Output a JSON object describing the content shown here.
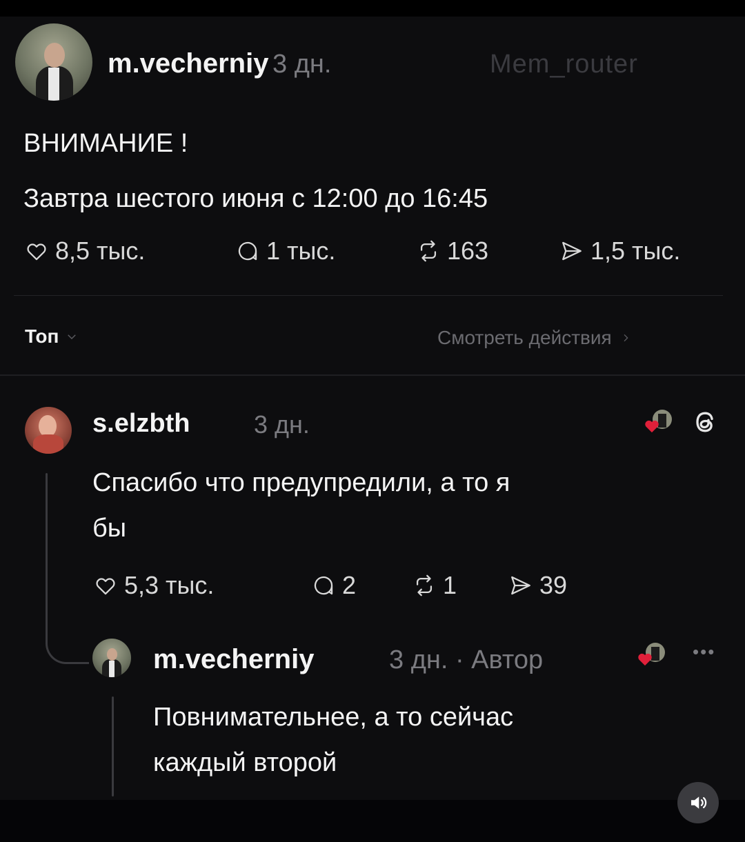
{
  "post": {
    "username": "m.vecherniy",
    "time": "3 дн.",
    "watermark": "Mem_router",
    "title": "ВНИМАНИЕ !",
    "body": "Завтра шестого июня с 12:00 до 16:45",
    "stats": {
      "likes": "8,5 тыс.",
      "comments": "1 тыс.",
      "reposts": "163",
      "shares": "1,5 тыс."
    }
  },
  "sort": {
    "label": "Топ",
    "actions_link": "Смотреть действия"
  },
  "reply1": {
    "username": "s.elzbth",
    "time": "3 дн.",
    "text_line1": "Спасибо что предупредили, а то я",
    "text_line2": "бы",
    "stats": {
      "likes": "5,3 тыс.",
      "comments": "2",
      "reposts": "1",
      "shares": "39"
    }
  },
  "reply2": {
    "username": "m.vecherniy",
    "meta": "3 дн. · Автор",
    "text_line1": "Повнимательнее, а то сейчас",
    "text_line2": "каждый второй"
  },
  "icons": {
    "like": "heart-outline-icon",
    "comment": "speech-bubble-icon",
    "repost": "repost-arrows-icon",
    "share": "send-icon",
    "threads": "threads-logo-icon",
    "more": "more-dots-icon",
    "sound": "speaker-icon",
    "liked_by_author": "liked-by-author-avatar-icon"
  },
  "colors": {
    "background": "#0d0d0f",
    "text": "#f4f4f4",
    "muted": "#7b7b80",
    "heart": "#e0203a"
  }
}
